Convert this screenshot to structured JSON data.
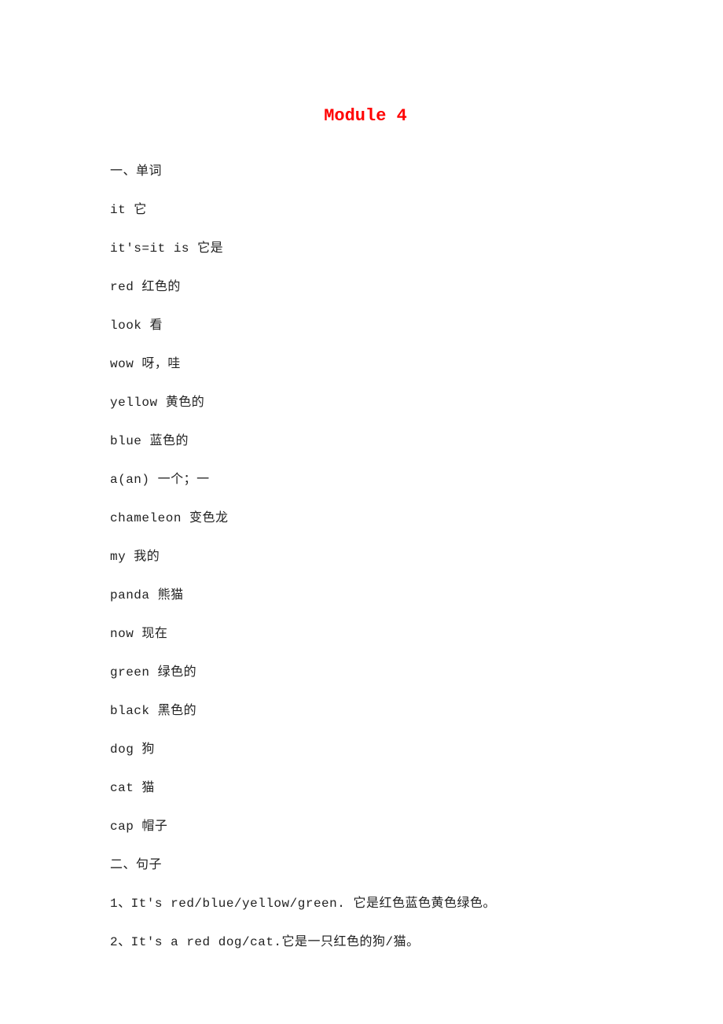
{
  "title": "Module 4",
  "sections": {
    "s1_heading": "一、单词",
    "vocab": [
      "it 它",
      "it's=it is 它是",
      "red 红色的",
      "look 看",
      "wow 呀，哇",
      "yellow 黄色的",
      "blue 蓝色的",
      "a(an) 一个；一",
      "chameleon 变色龙",
      "my 我的",
      "panda 熊猫",
      "now 现在",
      "green 绿色的",
      "black 黑色的",
      "dog 狗",
      "cat 猫",
      "cap 帽子"
    ],
    "s2_heading": "二、句子",
    "sentences": [
      "1、It's red/blue/yellow/green. 它是红色蓝色黄色绿色。",
      "2、It's a red dog/cat.它是一只红色的狗/猫。"
    ]
  }
}
